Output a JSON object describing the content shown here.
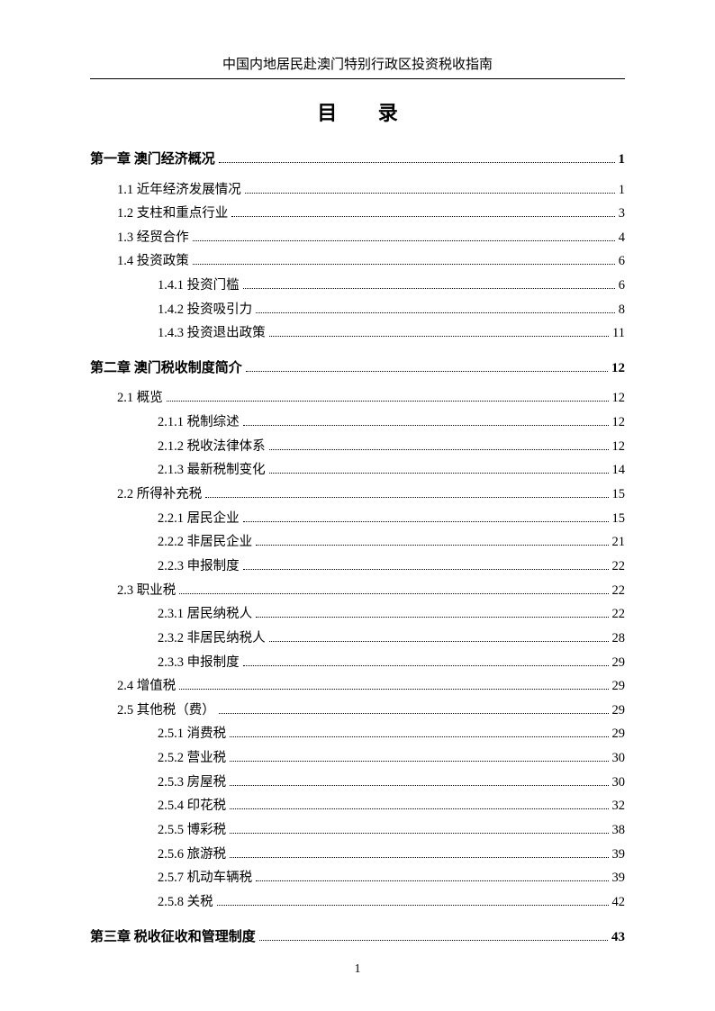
{
  "header": "中国内地居民赴澳门特别行政区投资税收指南",
  "toc_title": "目 录",
  "page_number": "1",
  "entries": [
    {
      "level": 0,
      "label": "第一章  澳门经济概况",
      "page": "1"
    },
    {
      "level": 1,
      "label": "1.1 近年经济发展情况",
      "page": "1"
    },
    {
      "level": 1,
      "label": "1.2 支柱和重点行业",
      "page": "3"
    },
    {
      "level": 1,
      "label": "1.3 经贸合作",
      "page": "4"
    },
    {
      "level": 1,
      "label": "1.4 投资政策",
      "page": "6"
    },
    {
      "level": 2,
      "label": "1.4.1 投资门槛",
      "page": "6"
    },
    {
      "level": 2,
      "label": "1.4.2 投资吸引力",
      "page": "8"
    },
    {
      "level": 2,
      "label": "1.4.3 投资退出政策",
      "page": "11"
    },
    {
      "level": 0,
      "label": "第二章  澳门税收制度简介",
      "page": "12"
    },
    {
      "level": 1,
      "label": "2.1 概览",
      "page": "12"
    },
    {
      "level": 2,
      "label": "2.1.1 税制综述",
      "page": "12"
    },
    {
      "level": 2,
      "label": "2.1.2 税收法律体系",
      "page": "12"
    },
    {
      "level": 2,
      "label": "2.1.3 最新税制变化",
      "page": "14"
    },
    {
      "level": 1,
      "label": "2.2 所得补充税",
      "page": "15"
    },
    {
      "level": 2,
      "label": "2.2.1 居民企业",
      "page": "15"
    },
    {
      "level": 2,
      "label": "2.2.2 非居民企业",
      "page": "21"
    },
    {
      "level": 2,
      "label": "2.2.3 申报制度",
      "page": "22"
    },
    {
      "level": 1,
      "label": "2.3 职业税",
      "page": "22"
    },
    {
      "level": 2,
      "label": "2.3.1 居民纳税人",
      "page": "22"
    },
    {
      "level": 2,
      "label": "2.3.2 非居民纳税人",
      "page": "28"
    },
    {
      "level": 2,
      "label": "2.3.3 申报制度",
      "page": "29"
    },
    {
      "level": 1,
      "label": "2.4 增值税",
      "page": "29"
    },
    {
      "level": 1,
      "label": "2.5 其他税（费）",
      "page": "29"
    },
    {
      "level": 2,
      "label": "2.5.1 消费税",
      "page": "29"
    },
    {
      "level": 2,
      "label": "2.5.2 营业税",
      "page": "30"
    },
    {
      "level": 2,
      "label": "2.5.3 房屋税",
      "page": "30"
    },
    {
      "level": 2,
      "label": "2.5.4 印花税",
      "page": "32"
    },
    {
      "level": 2,
      "label": "2.5.5 博彩税",
      "page": "38"
    },
    {
      "level": 2,
      "label": "2.5.6 旅游税",
      "page": "39"
    },
    {
      "level": 2,
      "label": "2.5.7 机动车辆税",
      "page": "39"
    },
    {
      "level": 2,
      "label": "2.5.8 关税",
      "page": "42"
    },
    {
      "level": 0,
      "label": "第三章  税收征收和管理制度",
      "page": "43"
    }
  ]
}
